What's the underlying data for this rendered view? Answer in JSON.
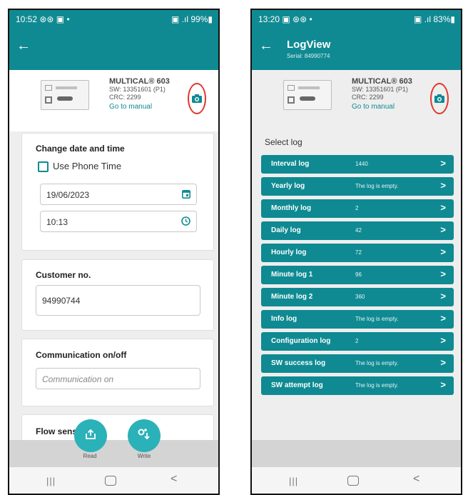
{
  "phone_left": {
    "status": {
      "time": "10:52 ⊛⊛ ▣ •",
      "right": "▣ .ıl 99%▮"
    },
    "device": {
      "model": "MULTICAL® 603",
      "sw": "SW: 13351601 (P1)",
      "crc": "CRC: 2299",
      "manual_link": "Go to manual"
    },
    "date_card": {
      "title": "Change date and time",
      "use_phone_time": "Use Phone Time",
      "date": "19/06/2023",
      "time": "10:13"
    },
    "customer_card": {
      "title": "Customer no.",
      "value": "94990744"
    },
    "comm_card": {
      "title": "Communication on/off",
      "value": "Communication on"
    },
    "flow_card": {
      "title": "Flow sensor in"
    },
    "actions": {
      "read": "Read",
      "write": "Write"
    },
    "nav": {
      "recent": "|||"
    }
  },
  "phone_right": {
    "status": {
      "time": "13:20 ▣ ⊛⊛ •",
      "right": "▣ .ıl 83%▮"
    },
    "appbar": {
      "title": "LogView",
      "serial": "Serial: 84990774"
    },
    "device": {
      "model": "MULTICAL® 603",
      "sw": "SW: 13351601 (P1)",
      "crc": "CRC: 2299",
      "manual_link": "Go to manual"
    },
    "select_label": "Select log",
    "logs": [
      {
        "name": "Interval log",
        "value": "1440"
      },
      {
        "name": "Yearly log",
        "value": "The log is empty."
      },
      {
        "name": "Monthly log",
        "value": "2"
      },
      {
        "name": "Daily log",
        "value": "42"
      },
      {
        "name": "Hourly log",
        "value": "72"
      },
      {
        "name": "Minute log 1",
        "value": "96"
      },
      {
        "name": "Minute log 2",
        "value": "360"
      },
      {
        "name": "Info log",
        "value": "The log is empty."
      },
      {
        "name": "Configuration log",
        "value": "2"
      },
      {
        "name": "SW success log",
        "value": "The log is empty."
      },
      {
        "name": "SW attempt log",
        "value": "The log is empty."
      }
    ],
    "nav": {
      "recent": "|||"
    }
  },
  "colors": {
    "primary": "#0f8a92",
    "fab": "#2bb1b8",
    "highlight": "#e0362c"
  }
}
